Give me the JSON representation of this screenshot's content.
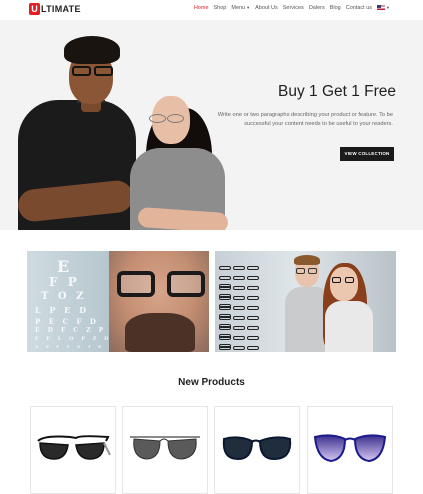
{
  "brand": {
    "logo_letter": "U",
    "name": "LTIMATE"
  },
  "nav": {
    "items": [
      {
        "label": "Home",
        "active": true
      },
      {
        "label": "Shop"
      },
      {
        "label": "Menu",
        "dropdown": true
      },
      {
        "label": "About Us"
      },
      {
        "label": "Services"
      },
      {
        "label": "Dalers"
      },
      {
        "label": "Blog"
      },
      {
        "label": "Contact us"
      }
    ],
    "language_flag": "us-flag-icon"
  },
  "hero": {
    "title": "Buy 1 Get 1 Free",
    "description": "Write one or two paragraphs describing your product or feature. To be successful your content needs to be useful to your readers.",
    "button_label": "VIEW COLLECTION"
  },
  "banners": {
    "eye_chart_rows": [
      "E",
      "F P",
      "T O Z",
      "L P E D",
      "P E C F D",
      "E D F C Z P",
      "F E L O P Z D",
      "D E F P O T E C"
    ]
  },
  "products_section": {
    "title": "New Products"
  },
  "products": [
    {
      "name": "black-sport-sunglasses"
    },
    {
      "name": "metal-aviator-sunglasses"
    },
    {
      "name": "navy-cat-eye-sunglasses"
    },
    {
      "name": "blue-purple-gradient-sunglasses"
    }
  ],
  "colors": {
    "accent": "#e31e24",
    "button": "#1a1a1a",
    "hero_bg": "#f3f3f3"
  }
}
